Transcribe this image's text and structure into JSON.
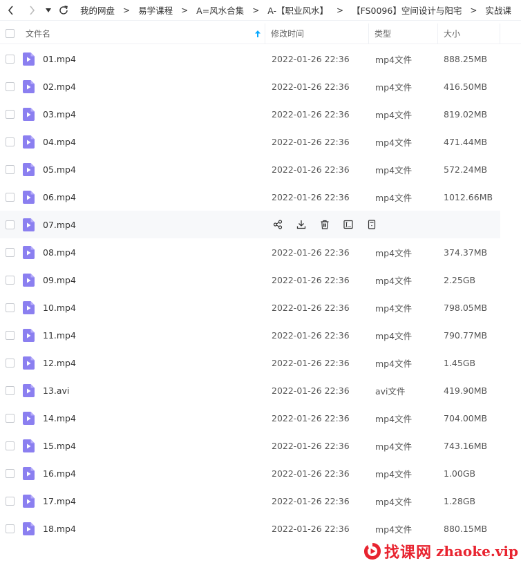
{
  "breadcrumb": [
    "我的网盘",
    "易学课程",
    "A=风水合集",
    "A-【职业风水】",
    "【FS0096】空间设计与阳宅",
    "实战课"
  ],
  "breadcrumb_sep": ">",
  "header": {
    "name": "文件名",
    "modified": "修改时间",
    "type": "类型",
    "size": "大小"
  },
  "files": [
    {
      "name": "01.mp4",
      "modified": "2022-01-26 22:36",
      "type": "mp4文件",
      "size": "888.25MB"
    },
    {
      "name": "02.mp4",
      "modified": "2022-01-26 22:36",
      "type": "mp4文件",
      "size": "416.50MB"
    },
    {
      "name": "03.mp4",
      "modified": "2022-01-26 22:36",
      "type": "mp4文件",
      "size": "819.02MB"
    },
    {
      "name": "04.mp4",
      "modified": "2022-01-26 22:36",
      "type": "mp4文件",
      "size": "471.44MB"
    },
    {
      "name": "05.mp4",
      "modified": "2022-01-26 22:36",
      "type": "mp4文件",
      "size": "572.24MB"
    },
    {
      "name": "06.mp4",
      "modified": "2022-01-26 22:36",
      "type": "mp4文件",
      "size": "1012.66MB"
    },
    {
      "name": "07.mp4",
      "hovered": true
    },
    {
      "name": "08.mp4",
      "modified": "2022-01-26 22:36",
      "type": "mp4文件",
      "size": "374.37MB"
    },
    {
      "name": "09.mp4",
      "modified": "2022-01-26 22:36",
      "type": "mp4文件",
      "size": "2.25GB"
    },
    {
      "name": "10.mp4",
      "modified": "2022-01-26 22:36",
      "type": "mp4文件",
      "size": "798.05MB"
    },
    {
      "name": "11.mp4",
      "modified": "2022-01-26 22:36",
      "type": "mp4文件",
      "size": "790.77MB"
    },
    {
      "name": "12.mp4",
      "modified": "2022-01-26 22:36",
      "type": "mp4文件",
      "size": "1.45GB"
    },
    {
      "name": "13.avi",
      "modified": "2022-01-26 22:36",
      "type": "avi文件",
      "size": "419.90MB"
    },
    {
      "name": "14.mp4",
      "modified": "2022-01-26 22:36",
      "type": "mp4文件",
      "size": "704.00MB"
    },
    {
      "name": "15.mp4",
      "modified": "2022-01-26 22:36",
      "type": "mp4文件",
      "size": "743.16MB"
    },
    {
      "name": "16.mp4",
      "modified": "2022-01-26 22:36",
      "type": "mp4文件",
      "size": "1.00GB"
    },
    {
      "name": "17.mp4",
      "modified": "2022-01-26 22:36",
      "type": "mp4文件",
      "size": "1.28GB"
    },
    {
      "name": "18.mp4",
      "modified": "2022-01-26 22:36",
      "type": "mp4文件",
      "size": "880.15MB"
    }
  ],
  "row_actions": [
    "share-icon",
    "download-icon",
    "delete-icon",
    "rename-icon",
    "more-icon"
  ],
  "colors": {
    "accent": "#06a7ff",
    "file_icon": "#8b7ff0",
    "watermark": "#e8232f"
  },
  "watermark": {
    "cn": "找课网",
    "en": "zhaoke.vip"
  }
}
